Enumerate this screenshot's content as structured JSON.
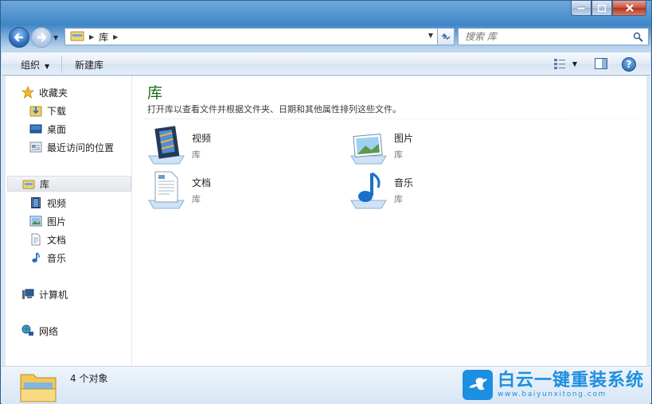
{
  "window": {
    "title_buttons": {
      "minimize_icon": "minimize-icon",
      "maximize_icon": "maximize-icon",
      "close_icon": "close-icon"
    }
  },
  "nav": {
    "breadcrumb": [
      "库"
    ],
    "search": {
      "placeholder": "搜索 库"
    }
  },
  "toolbar": {
    "organize_label": "组织",
    "new_library_label": "新建库"
  },
  "sidebar": {
    "favorites": {
      "label": "收藏夹",
      "items": [
        {
          "label": "下载",
          "icon": "downloads-icon"
        },
        {
          "label": "桌面",
          "icon": "desktop-icon"
        },
        {
          "label": "最近访问的位置",
          "icon": "recent-places-icon"
        }
      ]
    },
    "libraries": {
      "label": "库",
      "items": [
        {
          "label": "视频",
          "icon": "videos-icon"
        },
        {
          "label": "图片",
          "icon": "pictures-icon"
        },
        {
          "label": "文档",
          "icon": "documents-icon"
        },
        {
          "label": "音乐",
          "icon": "music-icon"
        }
      ]
    },
    "computer": {
      "label": "计算机"
    },
    "network": {
      "label": "网络"
    }
  },
  "main": {
    "title": "库",
    "description": "打开库以查看文件并根据文件夹、日期和其他属性排列这些文件。",
    "libraries": [
      {
        "name": "视频",
        "type": "库",
        "icon": "videos-library-icon"
      },
      {
        "name": "图片",
        "type": "库",
        "icon": "pictures-library-icon"
      },
      {
        "name": "文档",
        "type": "库",
        "icon": "documents-library-icon"
      },
      {
        "name": "音乐",
        "type": "库",
        "icon": "music-library-icon"
      }
    ]
  },
  "statusbar": {
    "item_count": "4 个对象"
  },
  "watermark": {
    "cn": "白云一键重装系统",
    "en": "www.baiyunxitong.com"
  },
  "colors": {
    "title_green": "#1e6d1e",
    "selection_bg": "#e6eaef",
    "watermark_blue": "#1d8fe0"
  }
}
